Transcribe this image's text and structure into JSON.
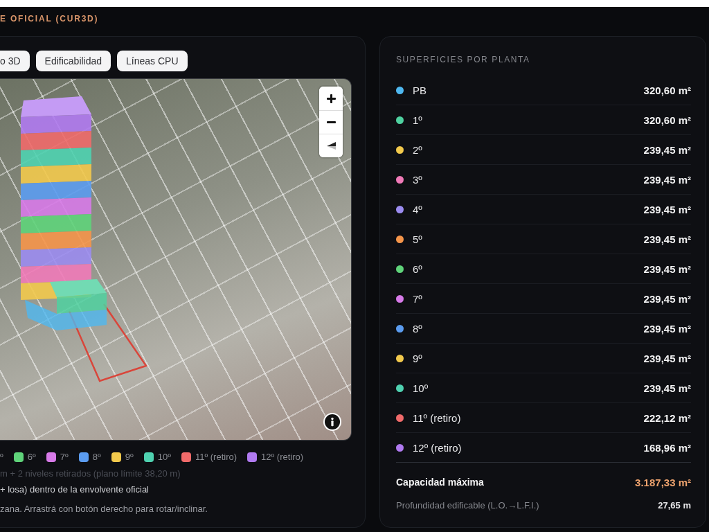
{
  "header": {
    "title": "E OFICIAL (CUR3D)"
  },
  "view_buttons": [
    {
      "label": "o 3D"
    },
    {
      "label": "Edificabilidad"
    },
    {
      "label": "Líneas CPU"
    }
  ],
  "legend": [
    {
      "label": "º"
    },
    {
      "label": "6º",
      "color": "#5fd37a"
    },
    {
      "label": "7º",
      "color": "#d77ae8"
    },
    {
      "label": "8º",
      "color": "#5b9cf0"
    },
    {
      "label": "9º",
      "color": "#f2c94c"
    },
    {
      "label": "10º",
      "color": "#4fd1b0"
    },
    {
      "label": "11º (retiro)",
      "color": "#f06a6a"
    },
    {
      "label": "12º (retiro)",
      "color": "#b07af0"
    }
  ],
  "notes": [
    {
      "kind": "muted",
      "text": "m + 2 niveles retirados (plano límite 38,20 m)"
    },
    {
      "kind": "emphasis",
      "text": "+ losa) dentro de la envolvente oficial"
    },
    {
      "kind": "hint",
      "text": "zana. Arrastrá con botón derecho para rotar/inclinar."
    }
  ],
  "floor_areas": {
    "title": "SUPERFICIES POR PLANTA",
    "rows": [
      {
        "label": "PB",
        "value": "320,60 m²",
        "color": "#4fb8f0"
      },
      {
        "label": "1º",
        "value": "320,60 m²",
        "color": "#4fd1a0"
      },
      {
        "label": "2º",
        "value": "239,45 m²",
        "color": "#f2c94c"
      },
      {
        "label": "3º",
        "value": "239,45 m²",
        "color": "#f07ab8"
      },
      {
        "label": "4º",
        "value": "239,45 m²",
        "color": "#9b8cf0"
      },
      {
        "label": "5º",
        "value": "239,45 m²",
        "color": "#f5954a"
      },
      {
        "label": "6º",
        "value": "239,45 m²",
        "color": "#5fd37a"
      },
      {
        "label": "7º",
        "value": "239,45 m²",
        "color": "#d77ae8"
      },
      {
        "label": "8º",
        "value": "239,45 m²",
        "color": "#5b9cf0"
      },
      {
        "label": "9º",
        "value": "239,45 m²",
        "color": "#f2c94c"
      },
      {
        "label": "10º",
        "value": "239,45 m²",
        "color": "#4fd1b0"
      },
      {
        "label": "11º (retiro)",
        "value": "222,12 m²",
        "color": "#f06a6a"
      },
      {
        "label": "12º (retiro)",
        "value": "168,96 m²",
        "color": "#b07af0"
      }
    ]
  },
  "totals": [
    {
      "kind": "primary",
      "label": "Capacidad máxima",
      "value": "3.187,33 m²"
    },
    {
      "kind": "secondary",
      "label": "Profundidad edificable (L.O.→L.F.I.)",
      "value": "27,65 m"
    }
  ]
}
